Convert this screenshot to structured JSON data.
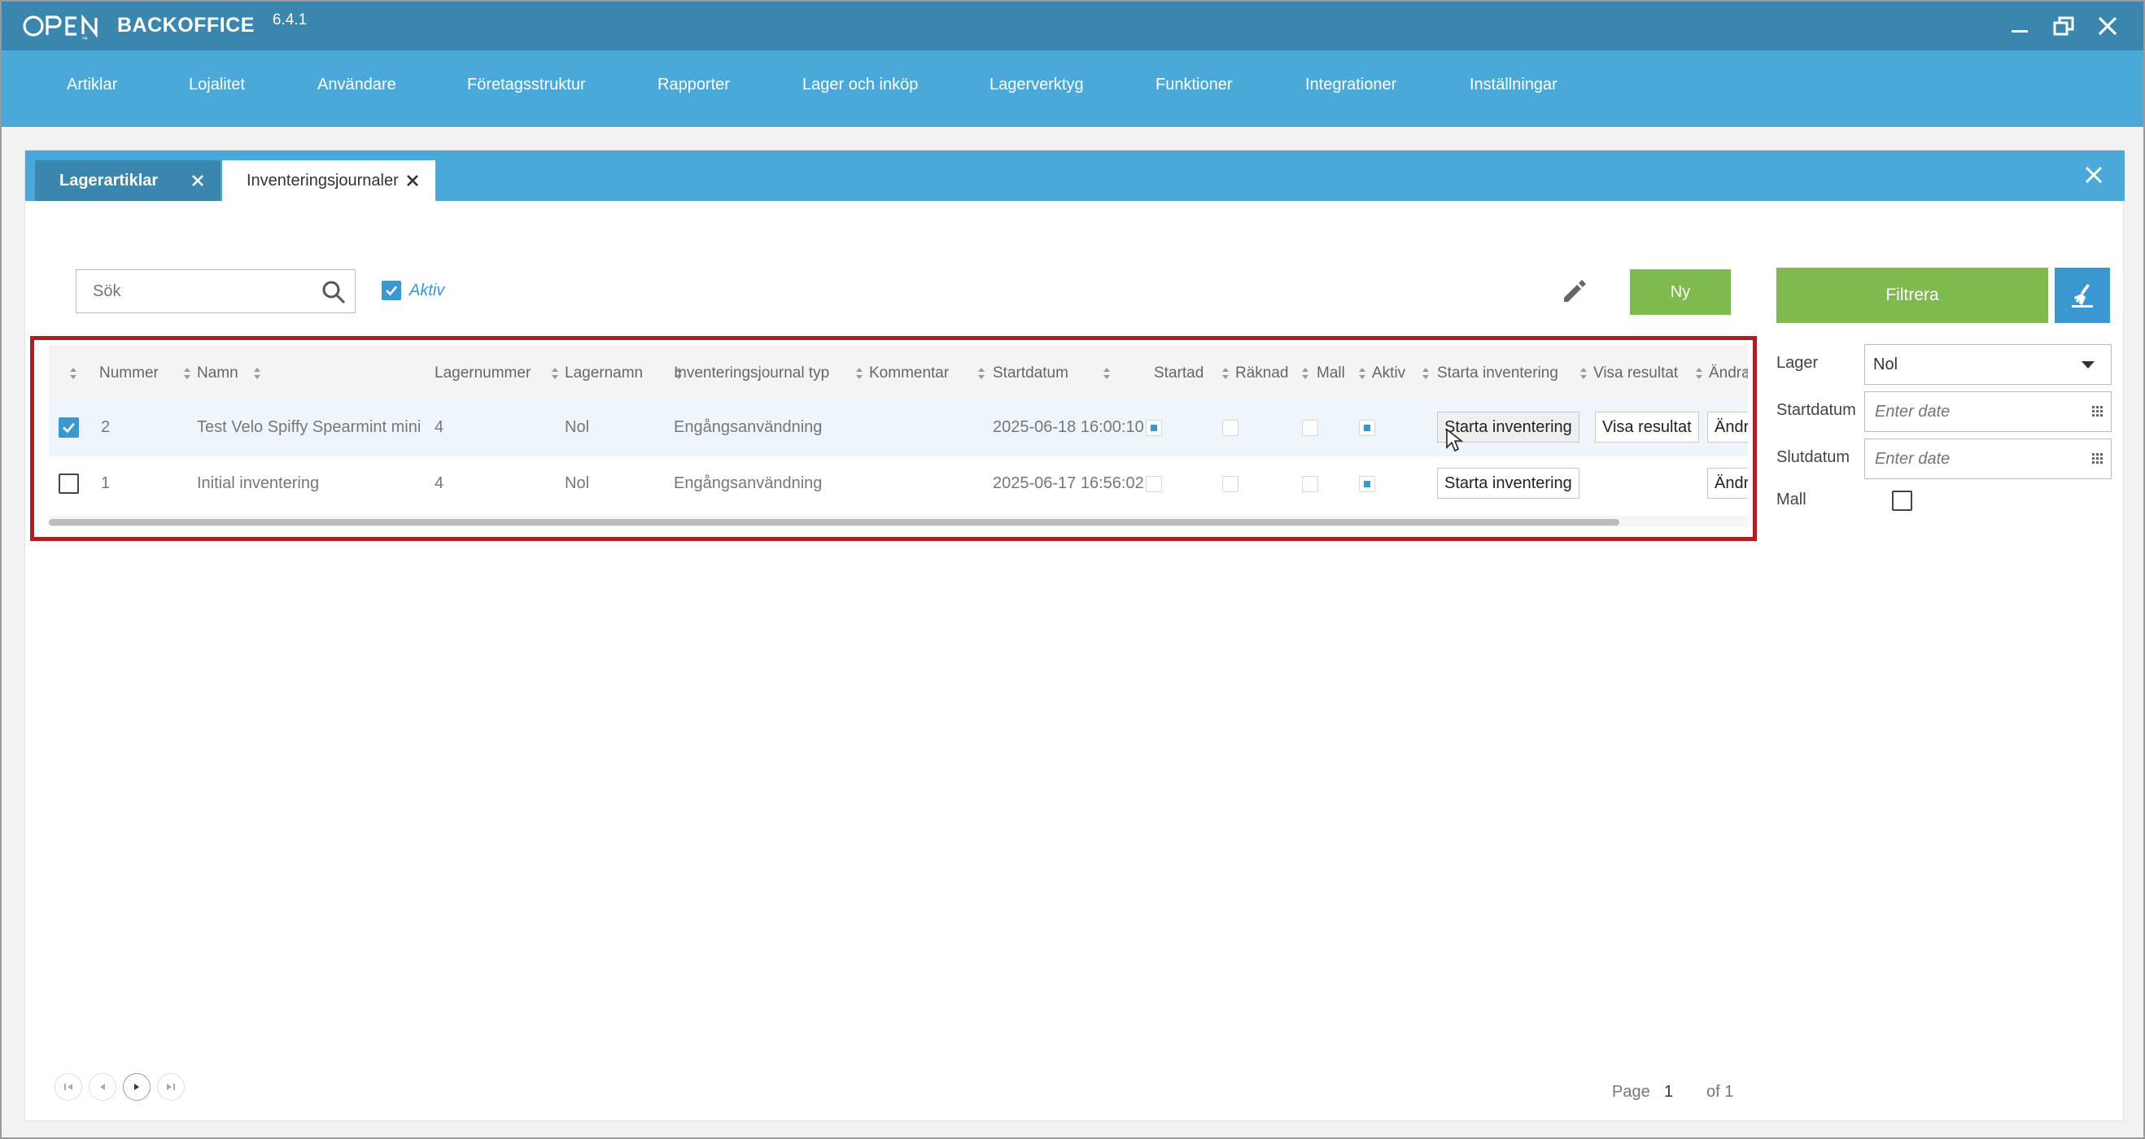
{
  "app": {
    "brand": "BACKOFFICE",
    "version": "6.4.1"
  },
  "menu": [
    "Artiklar",
    "Lojalitet",
    "Användare",
    "Företagsstruktur",
    "Rapporter",
    "Lager och inköp",
    "Lagerverktyg",
    "Funktioner",
    "Integrationer",
    "Inställningar"
  ],
  "tabs": [
    {
      "label": "Lagerartiklar",
      "active": false
    },
    {
      "label": "Inventeringsjournaler",
      "active": true
    }
  ],
  "toolbar": {
    "search_placeholder": "Sök",
    "aktiv_label": "Aktiv",
    "aktiv_checked": true,
    "new_label": "Ny"
  },
  "grid": {
    "columns": [
      "Nummer",
      "Namn",
      "Lagernummer",
      "Lagernamn",
      "Inventeringsjournal typ",
      "Kommentar",
      "Startdatum",
      "Startad",
      "Räknad",
      "Mall",
      "Aktiv",
      "Starta inventering",
      "Visa resultat",
      "Ändra"
    ],
    "rows": [
      {
        "selected": true,
        "nummer": "2",
        "namn": "Test Velo Spiffy Spearmint mini",
        "lagernummer": "4",
        "lagernamn": "Nol",
        "typ": "Engångsanvändning",
        "kommentar": "",
        "startdatum": "2025-06-18 16:00:10",
        "startad": true,
        "raknad": false,
        "mall": false,
        "aktiv": true,
        "starta_label": "Starta inventering",
        "visa_label": "Visa resultat",
        "andra_label": "Ändra"
      },
      {
        "selected": false,
        "nummer": "1",
        "namn": "Initial inventering",
        "lagernummer": "4",
        "lagernamn": "Nol",
        "typ": "Engångsanvändning",
        "kommentar": "",
        "startdatum": "2025-06-17 16:56:02",
        "startad": false,
        "raknad": false,
        "mall": false,
        "aktiv": true,
        "starta_label": "Starta inventering",
        "andra_label": "Ändra"
      }
    ]
  },
  "filter": {
    "button_label": "Filtrera",
    "lager_label": "Lager",
    "lager_value": "Nol",
    "startdatum_label": "Startdatum",
    "startdatum_placeholder": "Enter date",
    "slutdatum_label": "Slutdatum",
    "slutdatum_placeholder": "Enter date",
    "mall_label": "Mall",
    "mall_checked": false
  },
  "pager": {
    "page_label": "Page",
    "current_page": "1",
    "of_label": "of 1"
  },
  "colors": {
    "titlebar": "#3a86ae",
    "menubar": "#4aa9d8",
    "green": "#80b94e",
    "blue": "#3b97cf",
    "highlight": "#b01d22"
  }
}
